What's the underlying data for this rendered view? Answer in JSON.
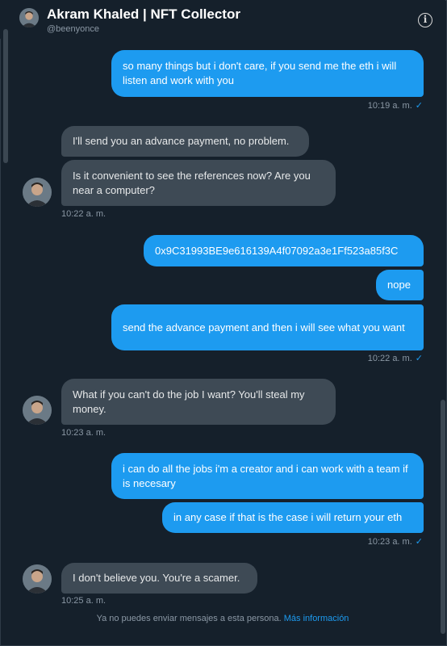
{
  "header": {
    "name": "Akram Khaled | NFT Collector",
    "handle": "@beenyonce"
  },
  "messages": [
    {
      "text": "so many things but i don't care, if you send me the eth i will listen and work with you",
      "dir": "out"
    },
    {
      "text": "I'll send you an advance payment, no problem.",
      "dir": "in"
    },
    {
      "text": "Is it convenient to see the references now? Are you near a computer?",
      "dir": "in"
    },
    {
      "text": "0x9C31993BE9e616139A4f07092a3e1Ff523a85f3C",
      "dir": "out"
    },
    {
      "text": "nope",
      "dir": "out"
    },
    {
      "text": "send the advance payment and then i will see what you want",
      "dir": "out"
    },
    {
      "text": "What if you can't do the job I want? You'll steal my money.",
      "dir": "in"
    },
    {
      "text": "i can do all the jobs i'm a creator and i can work with a team if is necesary",
      "dir": "out"
    },
    {
      "text": "in any case if that is the case i will return your eth",
      "dir": "out"
    },
    {
      "text": "I don't believe you. You're a scamer.",
      "dir": "in"
    }
  ],
  "timestamps": [
    "10:19 a. m.",
    "10:22 a. m.",
    "10:22 a. m.",
    "10:23 a. m.",
    "10:23 a. m.",
    "10:25 a. m."
  ],
  "read_check": "✓",
  "footer": {
    "text": "Ya no puedes enviar mensajes a esta persona.",
    "link": "Más información"
  },
  "colors": {
    "background": "#15202b",
    "outgoing_bubble": "#1d9bf0",
    "incoming_bubble": "#3e4a55",
    "accent": "#1d9bf0"
  },
  "icons": {
    "info": "info-icon",
    "avatar": "avatar-photo"
  }
}
